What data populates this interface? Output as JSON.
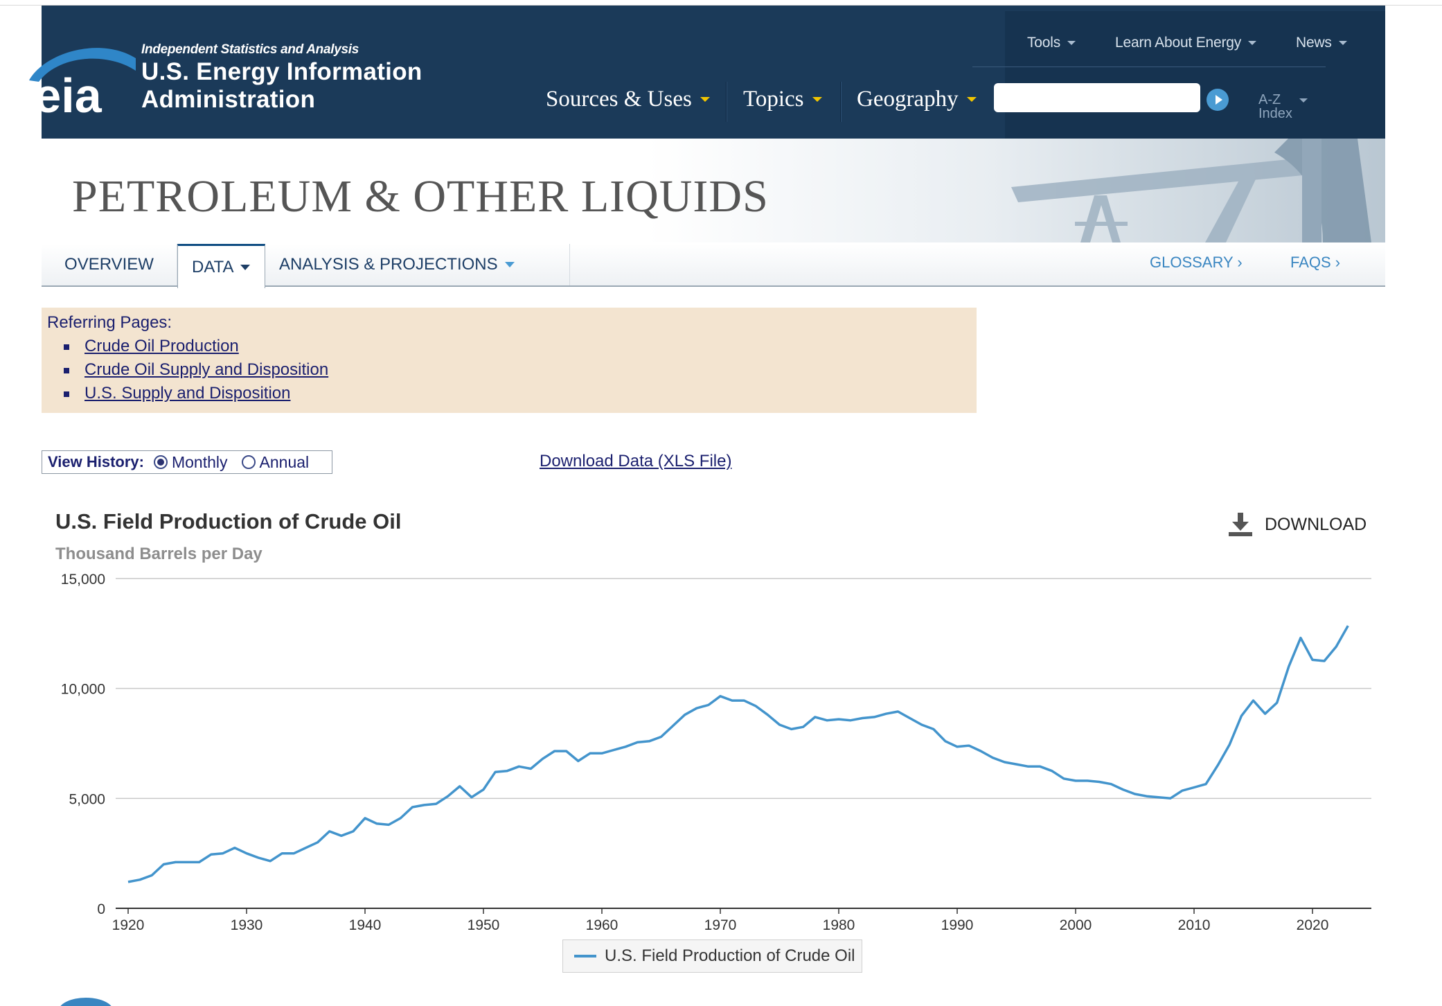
{
  "header": {
    "tagline": "Independent Statistics and Analysis",
    "org_line1": "U.S. Energy Information",
    "org_line2": "Administration",
    "logo_text": "eia",
    "main_nav": [
      "Sources & Uses",
      "Topics",
      "Geography"
    ],
    "util_nav": [
      "Tools",
      "Learn About Energy",
      "News"
    ],
    "search_value": "",
    "az_line1": "A-Z",
    "az_line2": "Index"
  },
  "banner": {
    "title": "PETROLEUM & OTHER LIQUIDS"
  },
  "tabs": {
    "overview": "OVERVIEW",
    "data": "DATA",
    "analysis": "ANALYSIS & PROJECTIONS",
    "glossary": "GLOSSARY ›",
    "faqs": "FAQS ›"
  },
  "referring": {
    "title": "Referring Pages:",
    "links": [
      "Crude Oil Production",
      "Crude Oil Supply and Disposition",
      "U.S. Supply and Disposition"
    ]
  },
  "view_history": {
    "label": "View History:",
    "options": [
      "Monthly",
      "Annual"
    ],
    "selected": "Monthly"
  },
  "download_xls": "Download Data (XLS File)",
  "download_button": "DOWNLOAD",
  "colors": {
    "header_bg": "#1b3a59",
    "accent_yellow": "#f2c500",
    "series": "#4394cc",
    "ref_bg": "#f3e4d0"
  },
  "chart_data": {
    "type": "line",
    "title": "U.S. Field Production of Crude Oil",
    "subtitle": "Thousand Barrels per Day",
    "xlabel": "",
    "ylabel": "",
    "xlim": [
      1920,
      2023.8
    ],
    "ylim": [
      0,
      15000
    ],
    "x_ticks": [
      "1920",
      "1930",
      "1940",
      "1950",
      "1960",
      "1970",
      "1980",
      "1990",
      "2000",
      "2010",
      "2020"
    ],
    "y_ticks": [
      "0",
      "5,000",
      "10,000",
      "15,000"
    ],
    "grid": true,
    "legend": "bottom-center",
    "series": [
      {
        "name": "U.S. Field Production of Crude Oil",
        "x": [
          1920,
          1921,
          1922,
          1923,
          1924,
          1925,
          1926,
          1927,
          1928,
          1929,
          1930,
          1931,
          1932,
          1933,
          1934,
          1935,
          1936,
          1937,
          1938,
          1939,
          1940,
          1941,
          1942,
          1943,
          1944,
          1945,
          1946,
          1947,
          1948,
          1949,
          1950,
          1951,
          1952,
          1953,
          1954,
          1955,
          1956,
          1957,
          1958,
          1959,
          1960,
          1961,
          1962,
          1963,
          1964,
          1965,
          1966,
          1967,
          1968,
          1969,
          1970,
          1971,
          1972,
          1973,
          1974,
          1975,
          1976,
          1977,
          1978,
          1979,
          1980,
          1981,
          1982,
          1983,
          1984,
          1985,
          1986,
          1987,
          1988,
          1989,
          1990,
          1991,
          1992,
          1993,
          1994,
          1995,
          1996,
          1997,
          1998,
          1999,
          2000,
          2001,
          2002,
          2003,
          2004,
          2005,
          2006,
          2007,
          2008,
          2009,
          2010,
          2011,
          2012,
          2013,
          2014,
          2015,
          2016,
          2017,
          2018,
          2019,
          2020,
          2021,
          2022,
          2023
        ],
        "values": [
          1200,
          1300,
          1500,
          2000,
          2100,
          2100,
          2100,
          2450,
          2500,
          2750,
          2500,
          2300,
          2150,
          2500,
          2500,
          2750,
          3000,
          3500,
          3300,
          3500,
          4100,
          3850,
          3800,
          4100,
          4600,
          4700,
          4750,
          5100,
          5550,
          5050,
          5400,
          6200,
          6250,
          6450,
          6350,
          6800,
          7150,
          7150,
          6700,
          7050,
          7050,
          7200,
          7350,
          7550,
          7600,
          7800,
          8300,
          8800,
          9100,
          9250,
          9650,
          9450,
          9450,
          9200,
          8800,
          8350,
          8150,
          8250,
          8700,
          8550,
          8600,
          8550,
          8650,
          8700,
          8850,
          8950,
          8650,
          8350,
          8150,
          7600,
          7350,
          7400,
          7150,
          6850,
          6650,
          6550,
          6450,
          6450,
          6250,
          5900,
          5800,
          5800,
          5750,
          5650,
          5400,
          5200,
          5100,
          5050,
          5000,
          5350,
          5500,
          5650,
          6500,
          7450,
          8750,
          9450,
          8850,
          9350,
          11000,
          12300,
          11300,
          11250,
          11900,
          12850
        ]
      }
    ]
  }
}
